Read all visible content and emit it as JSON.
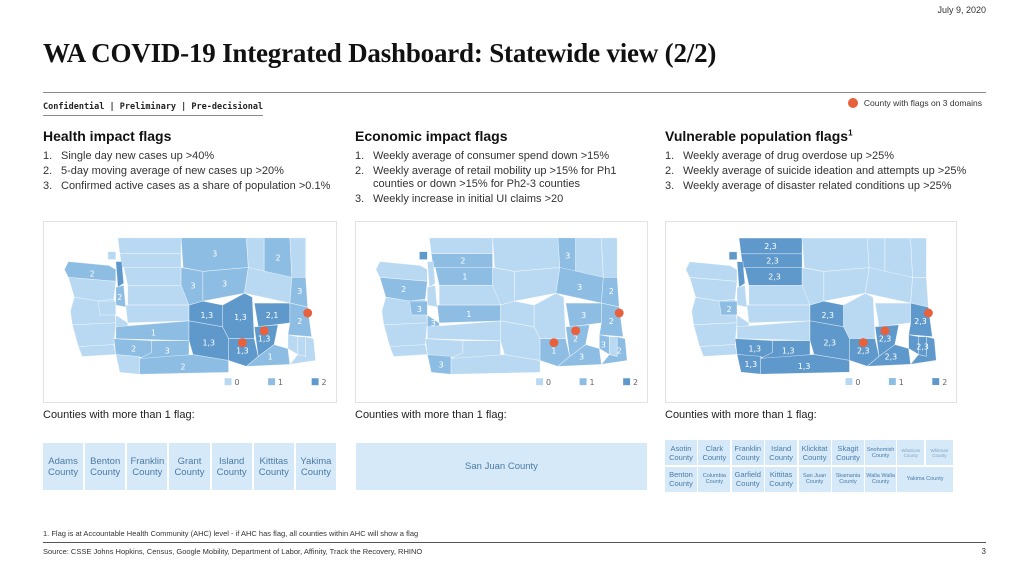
{
  "header": {
    "date": "July 9, 2020",
    "title": "WA COVID-19 Integrated Dashboard: Statewide view (2/2)",
    "confidentiality": "Confidential | Preliminary | Pre-decisional",
    "legend_label": "County with flags on 3 domains",
    "legend_color": "#e8603c"
  },
  "colors": {
    "level_0": "#b9d9f2",
    "level_1": "#8dbde3",
    "level_2": "#5f99cc",
    "flag_dot": "#e8603c",
    "county_cell_bg": "#d6e9f8",
    "county_cell_text": "#4a7ba6"
  },
  "columns": [
    {
      "title": "Health impact flags",
      "superscript": "",
      "items": [
        {
          "num": "1.",
          "text": "Single day new cases up >40%"
        },
        {
          "num": "2.",
          "text": "5-day moving average of new cases up >20%"
        },
        {
          "num": "3.",
          "text": "Confirmed active cases as a share of population >0.1%"
        }
      ],
      "counties_label": "Counties with more than 1 flag:",
      "counties": [
        "Adams County",
        "Benton County",
        "Franklin County",
        "Grant County",
        "Island County",
        "Kittitas County",
        "Yakima County"
      ]
    },
    {
      "title": "Economic impact flags",
      "superscript": "",
      "items": [
        {
          "num": "1.",
          "text": "Weekly average of consumer spend down >15%"
        },
        {
          "num": "2.",
          "text": "Weekly average of retail mobility up >15% for Ph1 counties or down >15% for Ph2-3 counties"
        },
        {
          "num": "3.",
          "text": "Weekly increase in initial UI claims >20"
        }
      ],
      "counties_label": "Counties with more than 1 flag:",
      "counties": [
        "San Juan County"
      ]
    },
    {
      "title": "Vulnerable population flags",
      "superscript": "1",
      "items": [
        {
          "num": "1.",
          "text": "Weekly average of drug overdose up >25%"
        },
        {
          "num": "2.",
          "text": "Weekly average of suicide ideation and attempts up >25%"
        },
        {
          "num": "3.",
          "text": "Weekly average of disaster related conditions up >25%"
        }
      ],
      "counties_label": "Counties with more than 1 flag:",
      "counties": [
        "Asotin County",
        "Clark County",
        "Franklin County",
        "Island County",
        "Klickitat County",
        "Skagit County",
        "Snohomish County",
        "Whatcom County",
        "Whitman County",
        "Benton County",
        "Columbia County",
        "Garfield County",
        "Kittitas County",
        "San Juan County",
        "Skamania County",
        "Walla Walla County",
        "Yakima County"
      ]
    }
  ],
  "map_legend": [
    {
      "label": "0",
      "level": 0
    },
    {
      "label": "1",
      "level": 1
    },
    {
      "label": "2",
      "level": 2
    }
  ],
  "maps": [
    {
      "name": "health",
      "regions": [
        {
          "id": "clallam",
          "level": 1,
          "label": "2"
        },
        {
          "id": "jefferson",
          "level": 0,
          "label": ""
        },
        {
          "id": "grays-harbor",
          "level": 0,
          "label": ""
        },
        {
          "id": "pacific",
          "level": 0,
          "label": ""
        },
        {
          "id": "wahkiakum",
          "level": 0,
          "label": ""
        },
        {
          "id": "whatcom",
          "level": 0,
          "label": ""
        },
        {
          "id": "skagit",
          "level": 0,
          "label": ""
        },
        {
          "id": "snohomish",
          "level": 0,
          "label": ""
        },
        {
          "id": "island",
          "level": 2,
          "label": ""
        },
        {
          "id": "san-juan",
          "level": 0,
          "label": ""
        },
        {
          "id": "kitsap",
          "level": 1,
          "label": "2"
        },
        {
          "id": "mason",
          "level": 0,
          "label": ""
        },
        {
          "id": "king",
          "level": 0,
          "label": ""
        },
        {
          "id": "pierce",
          "level": 0,
          "label": ""
        },
        {
          "id": "thurston",
          "level": 0,
          "label": ""
        },
        {
          "id": "lewis",
          "level": 1,
          "label": "1"
        },
        {
          "id": "cowlitz",
          "level": 1,
          "label": "2"
        },
        {
          "id": "clark",
          "level": 0,
          "label": ""
        },
        {
          "id": "skamania",
          "level": 1,
          "label": "3"
        },
        {
          "id": "klickitat",
          "level": 1,
          "label": "2"
        },
        {
          "id": "okanogan",
          "level": 1,
          "label": "3"
        },
        {
          "id": "chelan",
          "level": 1,
          "label": "3"
        },
        {
          "id": "douglas",
          "level": 1,
          "label": "3"
        },
        {
          "id": "ferry",
          "level": 0,
          "label": ""
        },
        {
          "id": "stevens",
          "level": 1,
          "label": "2"
        },
        {
          "id": "pend-oreille",
          "level": 0,
          "label": ""
        },
        {
          "id": "lincoln",
          "level": 0,
          "label": ""
        },
        {
          "id": "spokane",
          "level": 1,
          "label": "3"
        },
        {
          "id": "kittitas",
          "level": 2,
          "label": "1,3"
        },
        {
          "id": "grant",
          "level": 2,
          "label": "1,3"
        },
        {
          "id": "adams",
          "level": 2,
          "label": "2,1"
        },
        {
          "id": "whitman",
          "level": 1,
          "label": "2"
        },
        {
          "id": "yakima",
          "level": 2,
          "label": "1,3"
        },
        {
          "id": "benton",
          "level": 2,
          "label": "1,3"
        },
        {
          "id": "franklin",
          "level": 2,
          "label": "1,3"
        },
        {
          "id": "walla-walla",
          "level": 1,
          "label": "1"
        },
        {
          "id": "columbia",
          "level": 0,
          "label": ""
        },
        {
          "id": "garfield",
          "level": 0,
          "label": ""
        },
        {
          "id": "asotin",
          "level": 0,
          "label": ""
        }
      ],
      "flag_dots": [
        "benton",
        "franklin",
        "whitman"
      ]
    },
    {
      "name": "economic",
      "regions": [
        {
          "id": "clallam",
          "level": 0,
          "label": ""
        },
        {
          "id": "jefferson",
          "level": 1,
          "label": "2"
        },
        {
          "id": "grays-harbor",
          "level": 0,
          "label": ""
        },
        {
          "id": "pacific",
          "level": 0,
          "label": ""
        },
        {
          "id": "wahkiakum",
          "level": 0,
          "label": ""
        },
        {
          "id": "whatcom",
          "level": 0,
          "label": ""
        },
        {
          "id": "skagit",
          "level": 1,
          "label": "2"
        },
        {
          "id": "snohomish",
          "level": 1,
          "label": "1"
        },
        {
          "id": "island",
          "level": 0,
          "label": ""
        },
        {
          "id": "san-juan",
          "level": 2,
          "label": ""
        },
        {
          "id": "kitsap",
          "level": 0,
          "label": ""
        },
        {
          "id": "mason",
          "level": 1,
          "label": "3"
        },
        {
          "id": "king",
          "level": 0,
          "label": ""
        },
        {
          "id": "pierce",
          "level": 1,
          "label": "1"
        },
        {
          "id": "thurston",
          "level": 1,
          "label": "3"
        },
        {
          "id": "lewis",
          "level": 0,
          "label": ""
        },
        {
          "id": "cowlitz",
          "level": 0,
          "label": ""
        },
        {
          "id": "clark",
          "level": 1,
          "label": "3"
        },
        {
          "id": "skamania",
          "level": 0,
          "label": ""
        },
        {
          "id": "klickitat",
          "level": 0,
          "label": ""
        },
        {
          "id": "okanogan",
          "level": 0,
          "label": ""
        },
        {
          "id": "chelan",
          "level": 0,
          "label": ""
        },
        {
          "id": "douglas",
          "level": 0,
          "label": ""
        },
        {
          "id": "ferry",
          "level": 1,
          "label": "3"
        },
        {
          "id": "stevens",
          "level": 0,
          "label": ""
        },
        {
          "id": "pend-oreille",
          "level": 0,
          "label": ""
        },
        {
          "id": "lincoln",
          "level": 1,
          "label": "3"
        },
        {
          "id": "spokane",
          "level": 1,
          "label": "2"
        },
        {
          "id": "kittitas",
          "level": 0,
          "label": ""
        },
        {
          "id": "grant",
          "level": 0,
          "label": ""
        },
        {
          "id": "adams",
          "level": 1,
          "label": "3"
        },
        {
          "id": "whitman",
          "level": 1,
          "label": "2"
        },
        {
          "id": "yakima",
          "level": 0,
          "label": ""
        },
        {
          "id": "benton",
          "level": 1,
          "label": "1"
        },
        {
          "id": "franklin",
          "level": 1,
          "label": "2"
        },
        {
          "id": "walla-walla",
          "level": 1,
          "label": "3"
        },
        {
          "id": "columbia",
          "level": 1,
          "label": "3"
        },
        {
          "id": "garfield",
          "level": 0,
          "label": ""
        },
        {
          "id": "asotin",
          "level": 1,
          "label": "2"
        }
      ],
      "flag_dots": [
        "benton",
        "franklin",
        "whitman"
      ]
    },
    {
      "name": "vulnerable",
      "regions": [
        {
          "id": "clallam",
          "level": 0,
          "label": ""
        },
        {
          "id": "jefferson",
          "level": 0,
          "label": ""
        },
        {
          "id": "grays-harbor",
          "level": 0,
          "label": ""
        },
        {
          "id": "pacific",
          "level": 0,
          "label": ""
        },
        {
          "id": "wahkiakum",
          "level": 0,
          "label": ""
        },
        {
          "id": "whatcom",
          "level": 2,
          "label": "2,3"
        },
        {
          "id": "skagit",
          "level": 2,
          "label": "2,3"
        },
        {
          "id": "snohomish",
          "level": 2,
          "label": "2,3"
        },
        {
          "id": "island",
          "level": 2,
          "label": ""
        },
        {
          "id": "san-juan",
          "level": 2,
          "label": ""
        },
        {
          "id": "kitsap",
          "level": 0,
          "label": ""
        },
        {
          "id": "mason",
          "level": 1,
          "label": "2"
        },
        {
          "id": "king",
          "level": 0,
          "label": ""
        },
        {
          "id": "pierce",
          "level": 0,
          "label": ""
        },
        {
          "id": "thurston",
          "level": 0,
          "label": ""
        },
        {
          "id": "lewis",
          "level": 0,
          "label": ""
        },
        {
          "id": "cowlitz",
          "level": 2,
          "label": "1,3"
        },
        {
          "id": "clark",
          "level": 2,
          "label": "1,3"
        },
        {
          "id": "skamania",
          "level": 2,
          "label": "1,3"
        },
        {
          "id": "klickitat",
          "level": 2,
          "label": "1,3"
        },
        {
          "id": "okanogan",
          "level": 0,
          "label": ""
        },
        {
          "id": "chelan",
          "level": 0,
          "label": ""
        },
        {
          "id": "douglas",
          "level": 0,
          "label": ""
        },
        {
          "id": "ferry",
          "level": 0,
          "label": ""
        },
        {
          "id": "stevens",
          "level": 0,
          "label": ""
        },
        {
          "id": "pend-oreille",
          "level": 0,
          "label": ""
        },
        {
          "id": "lincoln",
          "level": 0,
          "label": ""
        },
        {
          "id": "spokane",
          "level": 0,
          "label": ""
        },
        {
          "id": "kittitas",
          "level": 2,
          "label": "2,3"
        },
        {
          "id": "grant",
          "level": 0,
          "label": ""
        },
        {
          "id": "adams",
          "level": 0,
          "label": ""
        },
        {
          "id": "whitman",
          "level": 2,
          "label": "2,3"
        },
        {
          "id": "yakima",
          "level": 2,
          "label": "2,3"
        },
        {
          "id": "benton",
          "level": 2,
          "label": "2,3"
        },
        {
          "id": "franklin",
          "level": 2,
          "label": "2,3"
        },
        {
          "id": "walla-walla",
          "level": 2,
          "label": "2,3"
        },
        {
          "id": "columbia",
          "level": 2,
          "label": ""
        },
        {
          "id": "garfield",
          "level": 2,
          "label": "2,3"
        },
        {
          "id": "asotin",
          "level": 2,
          "label": ""
        }
      ],
      "flag_dots": [
        "benton",
        "franklin",
        "whitman"
      ]
    }
  ],
  "footer": {
    "footnote": "1.   Flag is at Accountable Health Community (AHC) level - if AHC has flag, all counties within AHC will show a flag",
    "source": "Source: CSSE Johns Hopkins, Census, Google Mobility, Department of Labor, Affinity, Track the Recovery, RHINO",
    "page_number": "3"
  }
}
